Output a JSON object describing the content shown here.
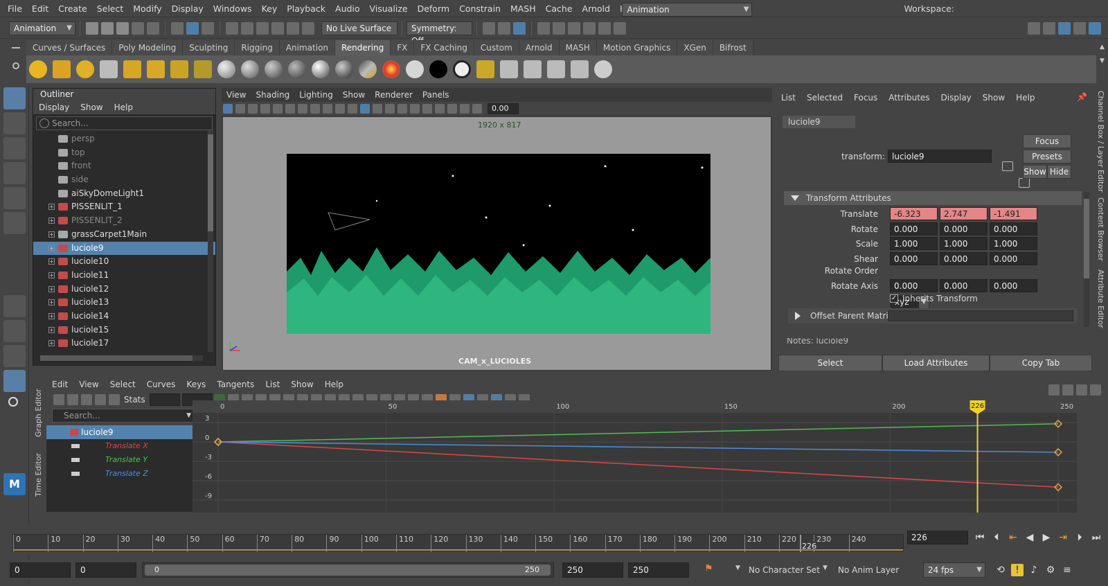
{
  "menubar": {
    "items": [
      "File",
      "Edit",
      "Create",
      "Select",
      "Modify",
      "Display",
      "Windows",
      "Key",
      "Playback",
      "Audio",
      "Visualize",
      "Deform",
      "Constrain",
      "MASH",
      "Cache",
      "Arnold",
      "Help"
    ],
    "workspace_label": "Workspace:",
    "workspace_value": "Animation"
  },
  "statusline": {
    "menuset": "Animation",
    "live_surface": "No Live Surface",
    "symmetry": "Symmetry: Off"
  },
  "shelf": {
    "tabs": [
      "Curves / Surfaces",
      "Poly Modeling",
      "Sculpting",
      "Rigging",
      "Animation",
      "Rendering",
      "FX",
      "FX Caching",
      "Custom",
      "Arnold",
      "MASH",
      "Motion Graphics",
      "XGen",
      "Bifrost"
    ],
    "active_tab": "Rendering"
  },
  "outliner": {
    "title": "Outliner",
    "menu": [
      "Display",
      "Show",
      "Help"
    ],
    "search_placeholder": "Search...",
    "items": [
      {
        "label": "persp",
        "dim": true,
        "icon": "camera-icon"
      },
      {
        "label": "top",
        "dim": true,
        "icon": "camera-icon"
      },
      {
        "label": "front",
        "dim": true,
        "icon": "camera-icon"
      },
      {
        "label": "side",
        "dim": true,
        "icon": "camera-icon"
      },
      {
        "label": "aiSkyDomeLight1",
        "icon": "skydome-light-icon"
      },
      {
        "label": "PISSENLIT_1",
        "expand": true,
        "icon": "transform-icon"
      },
      {
        "label": "PISSENLIT_2",
        "dim": true,
        "expand": true,
        "icon": "transform-icon"
      },
      {
        "label": "grassCarpet1Main",
        "expand": true,
        "icon": "group-icon"
      },
      {
        "label": "luciole9",
        "selected": true,
        "expand": true,
        "icon": "transform-icon"
      },
      {
        "label": "luciole10",
        "expand": true,
        "icon": "transform-icon"
      },
      {
        "label": "luciole11",
        "expand": true,
        "icon": "transform-icon"
      },
      {
        "label": "luciole12",
        "expand": true,
        "icon": "transform-icon"
      },
      {
        "label": "luciole13",
        "expand": true,
        "icon": "transform-icon"
      },
      {
        "label": "luciole14",
        "expand": true,
        "icon": "transform-icon"
      },
      {
        "label": "luciole15",
        "expand": true,
        "icon": "transform-icon"
      },
      {
        "label": "luciole17",
        "expand": true,
        "icon": "transform-icon"
      }
    ]
  },
  "viewport": {
    "menu": [
      "View",
      "Shading",
      "Lighting",
      "Show",
      "Renderer",
      "Panels"
    ],
    "exposure_value": "0.00",
    "resolution_gate": "1920 x 817",
    "camera_name": "CAM_x_LUCIOLES"
  },
  "attribute_editor": {
    "menu": [
      "List",
      "Selected",
      "Focus",
      "Attributes",
      "Display",
      "Show",
      "Help"
    ],
    "tab": "luciole9",
    "transform_label": "transform:",
    "transform_value": "luciole9",
    "focus_btn": "Focus",
    "presets_btn": "Presets",
    "show_btn": "Show",
    "hide_btn": "Hide",
    "section_transform": "Transform Attributes",
    "rows": [
      {
        "label": "Translate",
        "values": [
          "-6.323",
          "2.747",
          "-1.491"
        ],
        "keyed": true
      },
      {
        "label": "Rotate",
        "values": [
          "0.000",
          "0.000",
          "0.000"
        ]
      },
      {
        "label": "Scale",
        "values": [
          "1.000",
          "1.000",
          "1.000"
        ]
      },
      {
        "label": "Shear",
        "values": [
          "0.000",
          "0.000",
          "0.000"
        ]
      }
    ],
    "rotate_order_label": "Rotate Order",
    "rotate_order_value": "xyz",
    "rotate_axis_label": "Rotate Axis",
    "rotate_axis_values": [
      "0.000",
      "0.000",
      "0.000"
    ],
    "inherits_transform": "Inherits Transform",
    "section_offset": "Offset Parent Matrix",
    "notes_label": "Notes:  luciole9",
    "btn_select": "Select",
    "btn_load": "Load Attributes",
    "btn_copy": "Copy Tab",
    "side_tabs": [
      "Channel Box / Layer Editor",
      "Content Browser",
      "Attribute Editor"
    ]
  },
  "graph_editor": {
    "vtabs": [
      "Graph Editor",
      "Time Editor"
    ],
    "menu": [
      "Edit",
      "View",
      "Select",
      "Curves",
      "Keys",
      "Tangents",
      "List",
      "Show",
      "Help"
    ],
    "stats_label": "Stats",
    "search_placeholder": "Search...",
    "node": "luciole9",
    "channels": [
      {
        "label": "Translate X",
        "color": "#e04545"
      },
      {
        "label": "Translate Y",
        "color": "#4fbf4f"
      },
      {
        "label": "Translate Z",
        "color": "#4a8ee0"
      }
    ],
    "x_ticks": [
      "0",
      "50",
      "100",
      "150",
      "200",
      "250"
    ],
    "y_ticks": [
      "3",
      "0",
      "-3",
      "-6",
      "-9"
    ],
    "current_frame_label": "226"
  },
  "chart_data": {
    "type": "line",
    "x_range": [
      0,
      250
    ],
    "y_range": [
      -10.5,
      4.5
    ],
    "current_frame": 226,
    "series": [
      {
        "name": "Translate X",
        "color": "#e04545",
        "points": [
          [
            0,
            0
          ],
          [
            250,
            -7.0
          ]
        ]
      },
      {
        "name": "Translate Y",
        "color": "#4fbf4f",
        "points": [
          [
            0,
            0
          ],
          [
            250,
            2.8
          ]
        ]
      },
      {
        "name": "Translate Z",
        "color": "#4a8ee0",
        "points": [
          [
            0,
            0
          ],
          [
            250,
            -1.6
          ]
        ]
      }
    ]
  },
  "timeslider": {
    "ticks": [
      "0",
      "10",
      "20",
      "30",
      "40",
      "50",
      "60",
      "70",
      "80",
      "90",
      "100",
      "110",
      "120",
      "130",
      "140",
      "150",
      "160",
      "170",
      "180",
      "190",
      "200",
      "210",
      "220",
      "230",
      "240"
    ],
    "current_frame": "226",
    "current_label": "226"
  },
  "rangeslider": {
    "start": "0",
    "anim_start": "0",
    "range_start": "0",
    "range_end": "250",
    "anim_end": "250",
    "end": "250",
    "character_set": "No Character Set",
    "anim_layer": "No Anim Layer",
    "fps": "24 fps"
  }
}
